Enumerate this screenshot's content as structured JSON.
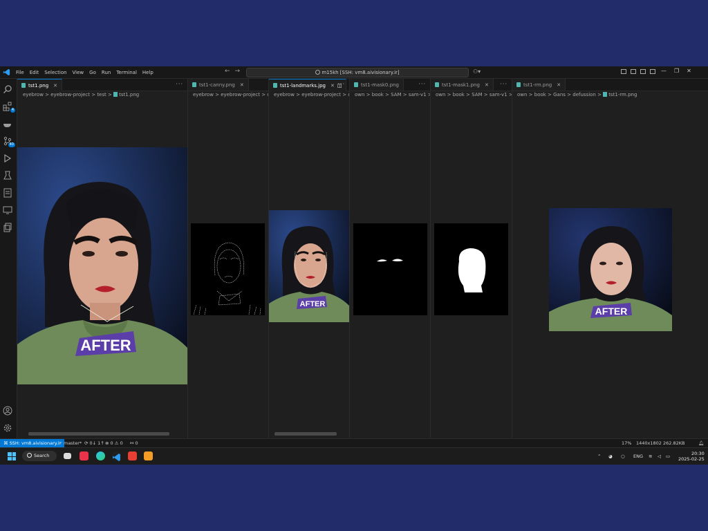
{
  "titlebar": {
    "menu": [
      "File",
      "Edit",
      "Selection",
      "View",
      "Go",
      "Run",
      "Terminal",
      "Help"
    ],
    "command_center": "m15kh [SSH: vm8.aivisionary.ir]"
  },
  "activity": {
    "extensions_badge": "4",
    "scm_badge": "40"
  },
  "panes": [
    {
      "tab": "tst1.png",
      "crumbs": "eyebrow  >  eyebrow-project  >  test  >",
      "file": "tst1.png"
    },
    {
      "tab": "tst1-canny.png",
      "crumbs": "eyebrow  >  eyebrow-project  >  outpu"
    },
    {
      "tab": "tst1-landmarks.jpg",
      "crumbs": "eyebrow  >  eyebrow-project  >  outpu"
    },
    {
      "tab": "tst1-mask0.png",
      "crumbs": "own  >  book  >  SAM  >  sam-v1  >  im"
    },
    {
      "tab": "tst1-mask1.png",
      "crumbs": "own  >  book  >  SAM  >  sam-v1  >  im"
    },
    {
      "tab": "tst1-rm.png",
      "crumbs": "own  >  book  >  Gans  >  defussion  >",
      "file": "tst1-rm.png"
    }
  ],
  "image_badge": "AFTER",
  "statusbar": {
    "remote": "SSH: vm8.aivisionary.ir",
    "branch": "master*",
    "sync": "0↓ 1↑",
    "problems": "0",
    "warnings": "0",
    "ports": "0",
    "zoom": "17%",
    "dimensions": "1440x1802",
    "filesize": "262.82KB"
  },
  "taskbar": {
    "search": "Search",
    "lang": "ENG",
    "time": "20:30",
    "date": "2025-02-25"
  },
  "colors": {
    "accent": "#0078d4",
    "badge_purple": "#5b3ea8",
    "sweater": "#6f8b5a"
  }
}
